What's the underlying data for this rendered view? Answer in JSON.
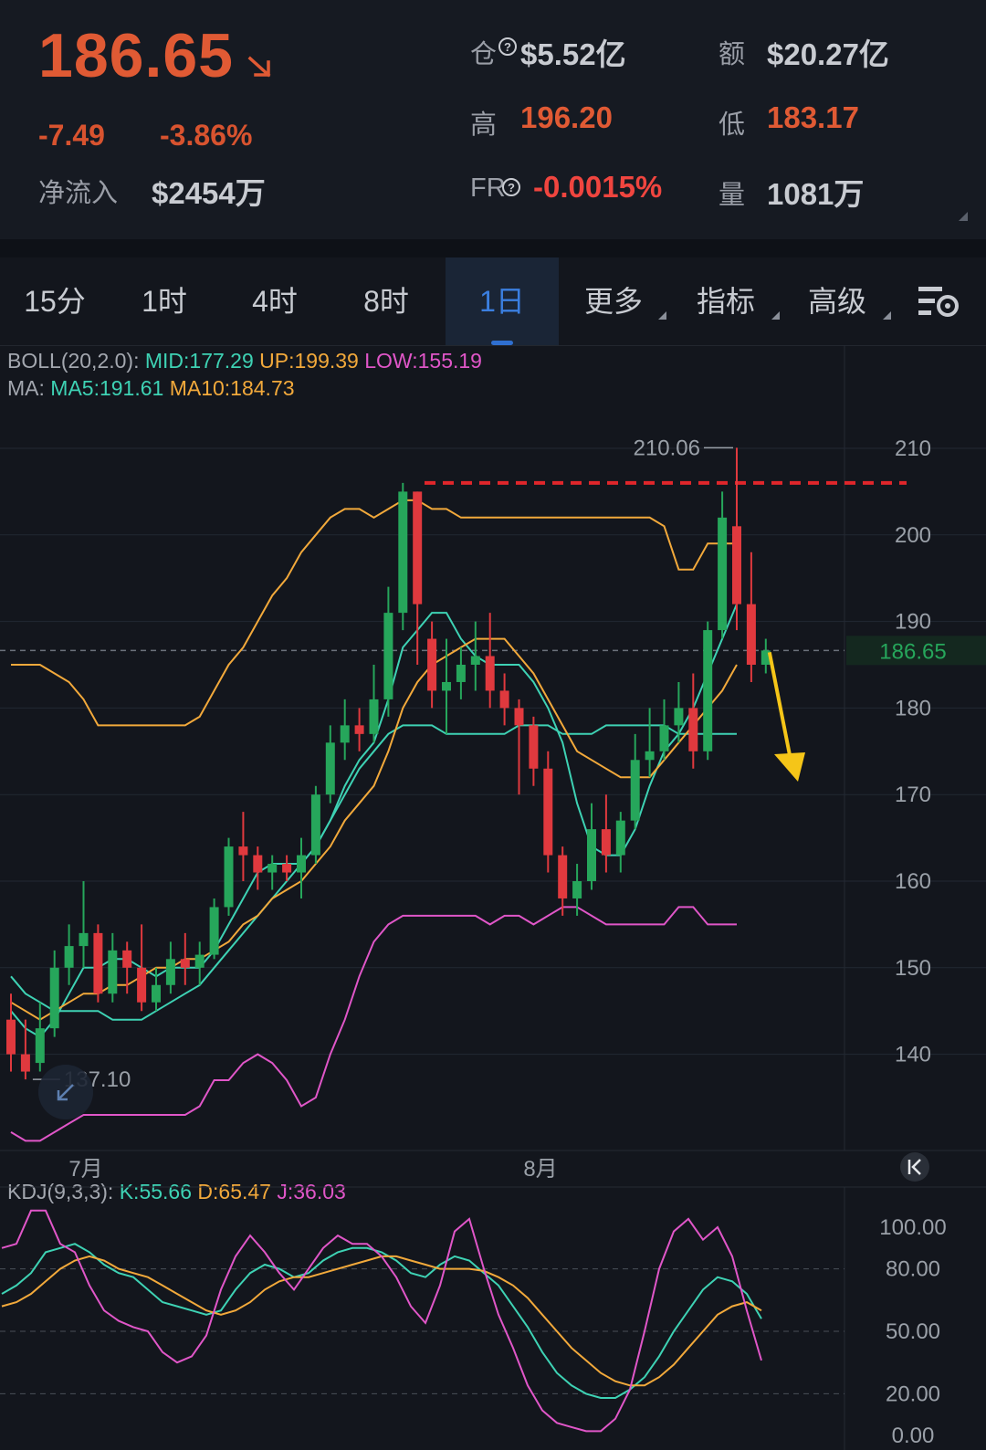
{
  "header": {
    "price": "186.65",
    "change": "-7.49",
    "change_pct": "-3.86%",
    "net_inflow_label": "净流入",
    "net_inflow_value": "$2454万",
    "oi_label": "仓",
    "oi_value": "$5.52亿",
    "amount_label": "额",
    "amount_value": "$20.27亿",
    "high_label": "高",
    "high_value": "196.20",
    "low_label": "低",
    "low_value": "183.17",
    "fr_label": "FR",
    "fr_value": "-0.0015%",
    "volume_label": "量",
    "volume_value": "1081万",
    "colors": {
      "down": "#e05a34",
      "fr": "#f0453f"
    }
  },
  "tabs": [
    {
      "label": "15分",
      "active": false
    },
    {
      "label": "1时",
      "active": false
    },
    {
      "label": "4时",
      "active": false
    },
    {
      "label": "8时",
      "active": false
    },
    {
      "label": "1日",
      "active": true
    },
    {
      "label": "更多",
      "active": false
    },
    {
      "label": "指标",
      "active": false
    },
    {
      "label": "高级",
      "active": false
    }
  ],
  "legend": {
    "boll_prefix": "BOLL(20,2.0):",
    "boll_mid": "MID:177.29",
    "boll_up": "UP:199.39",
    "boll_low": "LOW:155.19",
    "ma_prefix": "MA:",
    "ma5": "MA5:191.61",
    "ma10": "MA10:184.73",
    "kdj_prefix": "KDJ(9,3,3):",
    "kdj_k": "K:55.66",
    "kdj_d": "D:65.47",
    "kdj_j": "J:36.03"
  },
  "chart_data": [
    {
      "type": "candlestick",
      "title": "",
      "y_ticks": [
        210,
        200,
        190,
        180,
        170,
        160,
        150,
        140
      ],
      "ylim": [
        132,
        213
      ],
      "x_labels": [
        "7月",
        "8月"
      ],
      "current_price_label": "186.65",
      "max_label": "210.06",
      "min_label": "137.10",
      "resistance_level": 206,
      "colors": {
        "up": "#26a65b",
        "down": "#e0393e",
        "boll_mid": "#3ed2b4",
        "boll_up": "#f2a93b",
        "boll_low": "#e056c8",
        "ma5": "#3ed2b4",
        "ma10": "#f2a93b",
        "resistance": "#e0262b",
        "arrow": "#f5c518"
      },
      "candles": [
        {
          "o": 144,
          "c": 140,
          "h": 147,
          "l": 138
        },
        {
          "o": 140,
          "c": 138,
          "h": 144,
          "l": 137.1
        },
        {
          "o": 139,
          "c": 143,
          "h": 146,
          "l": 138
        },
        {
          "o": 143,
          "c": 150,
          "h": 152,
          "l": 142
        },
        {
          "o": 150,
          "c": 152.5,
          "h": 155,
          "l": 148
        },
        {
          "o": 152.5,
          "c": 154,
          "h": 160,
          "l": 150
        },
        {
          "o": 154,
          "c": 147,
          "h": 155,
          "l": 146
        },
        {
          "o": 147,
          "c": 152,
          "h": 154,
          "l": 146
        },
        {
          "o": 152,
          "c": 150,
          "h": 153,
          "l": 147
        },
        {
          "o": 150,
          "c": 146,
          "h": 155,
          "l": 145
        },
        {
          "o": 146,
          "c": 148,
          "h": 150,
          "l": 145
        },
        {
          "o": 148,
          "c": 151,
          "h": 153,
          "l": 147
        },
        {
          "o": 151,
          "c": 150,
          "h": 154,
          "l": 148
        },
        {
          "o": 150,
          "c": 151.5,
          "h": 153,
          "l": 148
        },
        {
          "o": 151.5,
          "c": 157,
          "h": 158,
          "l": 151
        },
        {
          "o": 157,
          "c": 164,
          "h": 165,
          "l": 156
        },
        {
          "o": 164,
          "c": 163,
          "h": 168,
          "l": 160
        },
        {
          "o": 163,
          "c": 161,
          "h": 164,
          "l": 159
        },
        {
          "o": 161,
          "c": 162,
          "h": 163,
          "l": 159
        },
        {
          "o": 162,
          "c": 161,
          "h": 163,
          "l": 160
        },
        {
          "o": 161,
          "c": 163,
          "h": 165,
          "l": 158
        },
        {
          "o": 163,
          "c": 170,
          "h": 171,
          "l": 162
        },
        {
          "o": 170,
          "c": 176,
          "h": 178,
          "l": 169
        },
        {
          "o": 176,
          "c": 178,
          "h": 181,
          "l": 174
        },
        {
          "o": 178,
          "c": 177,
          "h": 180,
          "l": 175
        },
        {
          "o": 177,
          "c": 181,
          "h": 185,
          "l": 176
        },
        {
          "o": 181,
          "c": 191,
          "h": 194,
          "l": 179
        },
        {
          "o": 191,
          "c": 205,
          "h": 206,
          "l": 189
        },
        {
          "o": 205,
          "c": 192,
          "h": 205,
          "l": 185
        },
        {
          "o": 188,
          "c": 182,
          "h": 190,
          "l": 180
        },
        {
          "o": 182,
          "c": 183,
          "h": 188,
          "l": 177
        },
        {
          "o": 183,
          "c": 185,
          "h": 187,
          "l": 181
        },
        {
          "o": 185,
          "c": 186,
          "h": 190,
          "l": 182
        },
        {
          "o": 186,
          "c": 182,
          "h": 191,
          "l": 180
        },
        {
          "o": 182,
          "c": 180,
          "h": 184,
          "l": 178
        },
        {
          "o": 180,
          "c": 178,
          "h": 181,
          "l": 170
        },
        {
          "o": 178,
          "c": 173,
          "h": 179,
          "l": 171
        },
        {
          "o": 173,
          "c": 163,
          "h": 175,
          "l": 161
        },
        {
          "o": 163,
          "c": 158,
          "h": 164,
          "l": 156
        },
        {
          "o": 158,
          "c": 160,
          "h": 162,
          "l": 156
        },
        {
          "o": 160,
          "c": 166,
          "h": 169,
          "l": 159
        },
        {
          "o": 166,
          "c": 163,
          "h": 170,
          "l": 161
        },
        {
          "o": 163,
          "c": 167,
          "h": 168,
          "l": 161
        },
        {
          "o": 167,
          "c": 174,
          "h": 177,
          "l": 166
        },
        {
          "o": 174,
          "c": 175,
          "h": 180,
          "l": 172
        },
        {
          "o": 175,
          "c": 178,
          "h": 181,
          "l": 174
        },
        {
          "o": 178,
          "c": 180,
          "h": 183,
          "l": 176
        },
        {
          "o": 180,
          "c": 175,
          "h": 184,
          "l": 173
        },
        {
          "o": 175,
          "c": 189,
          "h": 190,
          "l": 174
        },
        {
          "o": 189,
          "c": 202,
          "h": 205,
          "l": 188
        },
        {
          "o": 201,
          "c": 192,
          "h": 210.06,
          "l": 189
        },
        {
          "o": 192,
          "c": 185,
          "h": 198,
          "l": 183
        },
        {
          "o": 185,
          "c": 186.65,
          "h": 188,
          "l": 184
        }
      ],
      "boll_up": [
        185,
        185,
        185,
        184,
        183,
        181,
        178,
        178,
        178,
        178,
        178,
        178,
        178,
        179,
        182,
        185,
        187,
        190,
        193,
        195,
        198,
        200,
        202,
        203,
        203,
        202,
        203,
        204,
        204,
        203,
        203,
        202,
        202,
        202,
        202,
        202,
        202,
        202,
        202,
        202,
        202,
        202,
        202,
        202,
        202,
        201,
        196,
        196,
        199,
        199,
        199
      ],
      "boll_mid": [
        149,
        147,
        146,
        145,
        145,
        145,
        145,
        144,
        144,
        144,
        145,
        146,
        147,
        148,
        150,
        152,
        154,
        156,
        158,
        160,
        162,
        164,
        167,
        170,
        173,
        175,
        177,
        178,
        178,
        178,
        177,
        177,
        177,
        177,
        177,
        178,
        178,
        178,
        177,
        177,
        177,
        178,
        178,
        178,
        178,
        178,
        177,
        177,
        177,
        177,
        177
      ],
      "boll_low": [
        131,
        130,
        130,
        131,
        132,
        133,
        133,
        133,
        133,
        133,
        133,
        133,
        133,
        134,
        137,
        137,
        139,
        140,
        139,
        137,
        134,
        135,
        140,
        144,
        149,
        153,
        155,
        156,
        156,
        156,
        156,
        156,
        156,
        155,
        156,
        156,
        155,
        156,
        157,
        157,
        156,
        155,
        155,
        155,
        155,
        155,
        157,
        157,
        155,
        155,
        155
      ],
      "ma5": [
        145,
        143,
        142,
        144,
        147,
        150,
        150,
        151,
        151,
        150,
        149,
        150,
        150,
        150,
        152,
        155,
        158,
        161,
        162,
        162,
        162,
        164,
        167,
        171,
        174,
        176,
        181,
        187,
        189,
        191,
        191,
        188,
        186,
        185,
        185,
        185,
        183,
        180,
        176,
        169,
        164,
        163,
        163,
        166,
        171,
        175,
        177,
        180,
        184,
        188,
        192
      ],
      "ma10": [
        146,
        145,
        144,
        145,
        146,
        147,
        147,
        148,
        148,
        149,
        150,
        150,
        151,
        151,
        152,
        153,
        155,
        156,
        158,
        159,
        160,
        162,
        164,
        167,
        169,
        171,
        175,
        180,
        183,
        185,
        186,
        187,
        188,
        188,
        188,
        186,
        184,
        181,
        178,
        175,
        174,
        173,
        172,
        172,
        172,
        174,
        176,
        178,
        180,
        182,
        185
      ]
    },
    {
      "type": "line",
      "title": "",
      "y_ticks": [
        100,
        80,
        50,
        20,
        0
      ],
      "ylim": [
        0,
        110
      ],
      "series": [
        {
          "name": "K",
          "color": "#3ed2b4",
          "values": [
            68,
            72,
            78,
            88,
            90,
            92,
            88,
            82,
            78,
            76,
            70,
            64,
            62,
            60,
            58,
            60,
            70,
            78,
            82,
            80,
            76,
            78,
            84,
            88,
            90,
            90,
            88,
            84,
            78,
            76,
            82,
            86,
            84,
            78,
            72,
            62,
            52,
            40,
            30,
            24,
            20,
            18,
            18,
            22,
            28,
            38,
            50,
            60,
            70,
            76,
            74,
            68,
            56
          ]
        },
        {
          "name": "D",
          "color": "#f2a93b",
          "values": [
            62,
            64,
            68,
            74,
            80,
            84,
            86,
            84,
            80,
            78,
            76,
            72,
            68,
            64,
            60,
            58,
            60,
            64,
            70,
            74,
            76,
            76,
            78,
            80,
            82,
            84,
            86,
            86,
            84,
            82,
            80,
            80,
            80,
            79,
            76,
            72,
            66,
            58,
            50,
            42,
            36,
            30,
            26,
            24,
            24,
            28,
            34,
            42,
            50,
            58,
            62,
            64,
            60
          ]
        },
        {
          "name": "J",
          "color": "#e056c8",
          "values": [
            90,
            92,
            110,
            108,
            92,
            88,
            72,
            60,
            55,
            52,
            50,
            40,
            35,
            38,
            48,
            70,
            86,
            96,
            88,
            78,
            70,
            80,
            90,
            96,
            92,
            92,
            86,
            76,
            62,
            54,
            72,
            98,
            104,
            80,
            58,
            42,
            24,
            12,
            6,
            4,
            2,
            2,
            8,
            22,
            50,
            80,
            98,
            104,
            94,
            100,
            86,
            60,
            36
          ]
        }
      ]
    }
  ]
}
